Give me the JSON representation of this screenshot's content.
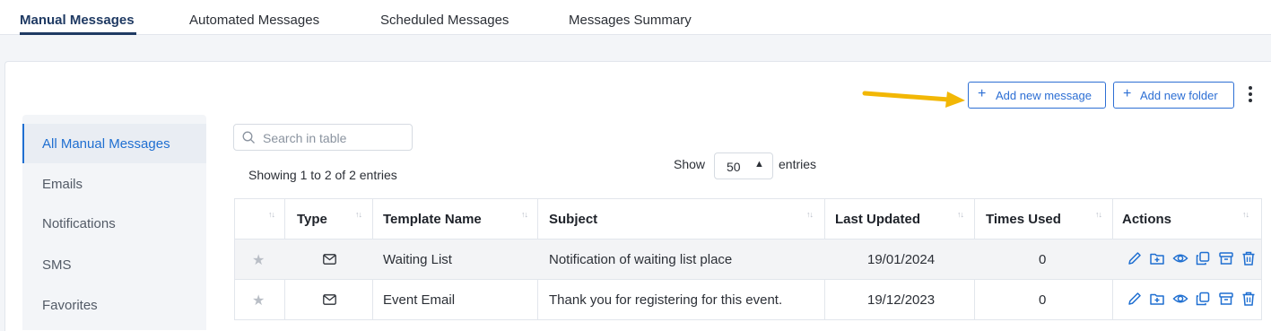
{
  "tabs": [
    {
      "label": "Manual Messages",
      "active": true
    },
    {
      "label": "Automated Messages",
      "active": false
    },
    {
      "label": "Scheduled Messages",
      "active": false
    },
    {
      "label": "Messages Summary",
      "active": false
    }
  ],
  "toolbar": {
    "add_message_label": "Add new message",
    "add_folder_label": "Add new folder"
  },
  "sidebar": {
    "items": [
      {
        "label": "All Manual Messages",
        "active": true
      },
      {
        "label": "Emails"
      },
      {
        "label": "Notifications"
      },
      {
        "label": "SMS"
      },
      {
        "label": "Favorites"
      }
    ]
  },
  "search": {
    "placeholder": "Search in table",
    "value": ""
  },
  "pagination": {
    "showing": "Showing 1 to 2 of 2 entries",
    "show_label": "Show",
    "page_size": "50",
    "entries_label": "entries"
  },
  "table": {
    "columns": [
      "",
      "Type",
      "Template Name",
      "Subject",
      "Last Updated",
      "Times Used",
      "Actions"
    ],
    "rows": [
      {
        "type_icon": "envelope-icon",
        "template_name": "Waiting List",
        "subject": "Notification of waiting list place",
        "last_updated": "19/01/2024",
        "times_used": "0"
      },
      {
        "type_icon": "envelope-icon",
        "template_name": "Event Email",
        "subject": "Thank you for registering for this event.",
        "last_updated": "19/12/2023",
        "times_used": "0"
      }
    ],
    "action_icons": [
      "edit-icon",
      "move-to-folder-icon",
      "view-icon",
      "duplicate-icon",
      "archive-icon",
      "delete-icon"
    ]
  },
  "colors": {
    "accent": "#2d6fd4",
    "tab_active": "#1f3a63",
    "arrow": "#f2b705"
  }
}
